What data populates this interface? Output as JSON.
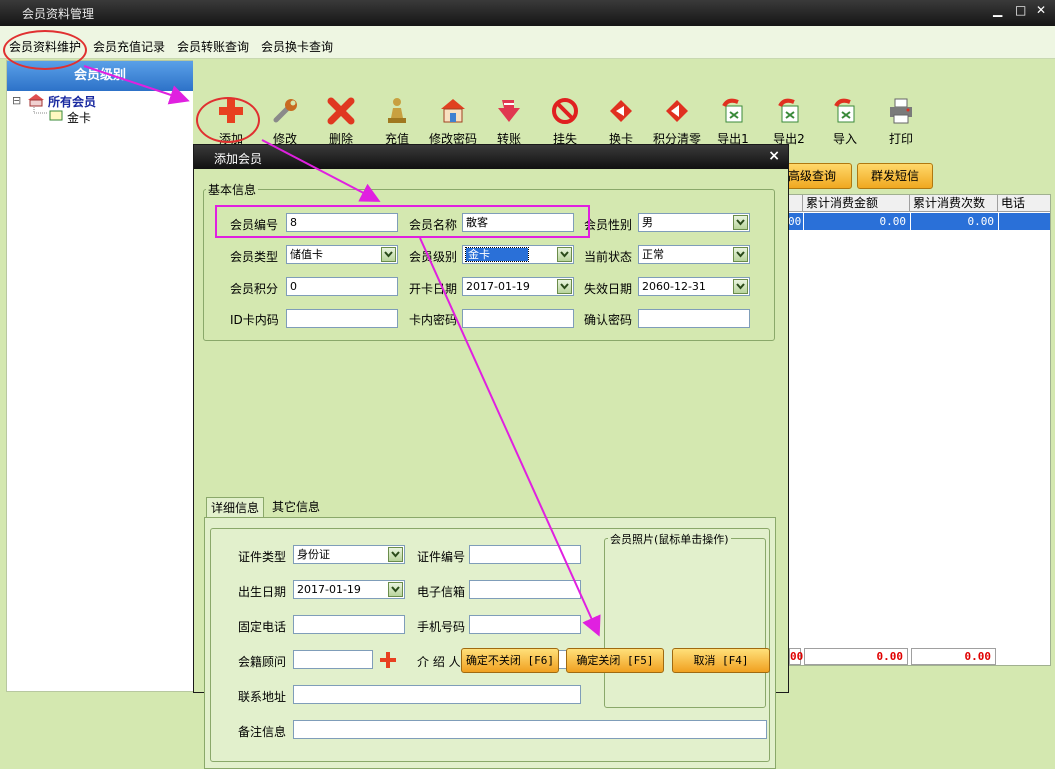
{
  "window": {
    "title": "会员资料管理",
    "min": "▁",
    "max": "□",
    "close": "✕"
  },
  "menu": [
    "会员资料维护",
    "会员充值记录",
    "会员转账查询",
    "会员换卡查询"
  ],
  "left_panel": {
    "header": "会员级别",
    "tree_root": "所有会员",
    "tree_child": "金卡",
    "collapse_sign": "⊟"
  },
  "toolbar": [
    "添加",
    "修改",
    "删除",
    "充值",
    "修改密码",
    "转账",
    "挂失",
    "换卡",
    "积分清零",
    "导出1",
    "导出2",
    "导入",
    "打印"
  ],
  "right_buttons": {
    "advanced_query": "高级查询",
    "group_sms": "群发短信"
  },
  "grid": {
    "columns": [
      "累计消费金额",
      "累计消费次数",
      "电话"
    ],
    "partial_col": "00",
    "row_values": [
      "0.00",
      "0.00"
    ],
    "totals": [
      "00",
      "0.00",
      "0.00"
    ]
  },
  "dialog": {
    "title": "添加会员",
    "close": "×",
    "basic_group": "基本信息",
    "fields": {
      "member_no": {
        "label": "会员编号",
        "value": "8"
      },
      "member_name": {
        "label": "会员名称",
        "value": "散客"
      },
      "gender": {
        "label": "会员性别",
        "value": "男"
      },
      "member_type": {
        "label": "会员类型",
        "value": "储值卡"
      },
      "member_level": {
        "label": "会员级别",
        "value": "金卡"
      },
      "status": {
        "label": "当前状态",
        "value": "正常"
      },
      "points": {
        "label": "会员积分",
        "value": "0"
      },
      "open_date": {
        "label": "开卡日期",
        "value": "2017-01-19"
      },
      "expire_date": {
        "label": "失效日期",
        "value": "2060-12-31"
      },
      "id_card_code": {
        "label": "ID卡内码",
        "value": ""
      },
      "card_password": {
        "label": "卡内密码",
        "value": ""
      },
      "confirm_password": {
        "label": "确认密码",
        "value": ""
      }
    },
    "tabs": [
      "详细信息",
      "其它信息"
    ],
    "detail": {
      "id_type": {
        "label": "证件类型",
        "value": "身份证"
      },
      "id_no": {
        "label": "证件编号",
        "value": ""
      },
      "birth_date": {
        "label": "出生日期",
        "value": "2017-01-19"
      },
      "email": {
        "label": "电子信箱",
        "value": ""
      },
      "phone": {
        "label": "固定电话",
        "value": ""
      },
      "mobile": {
        "label": "手机号码",
        "value": ""
      },
      "advisor": {
        "label": "会籍顾问",
        "value": ""
      },
      "referrer": {
        "label": "介 绍 人",
        "value": ""
      },
      "address": {
        "label": "联系地址",
        "value": ""
      },
      "remarks": {
        "label": "备注信息",
        "value": ""
      },
      "photo_group": "会员照片(鼠标单击操作)"
    },
    "buttons": {
      "save_keep": "确定不关闭 [F6]",
      "save_close": "确定关闭 [F5]",
      "cancel": "取消 [F4]"
    }
  },
  "colors": {
    "annotation_ring": "#e03030",
    "annotation_arrow": "#e020e0",
    "selection": "#2a70d8"
  }
}
